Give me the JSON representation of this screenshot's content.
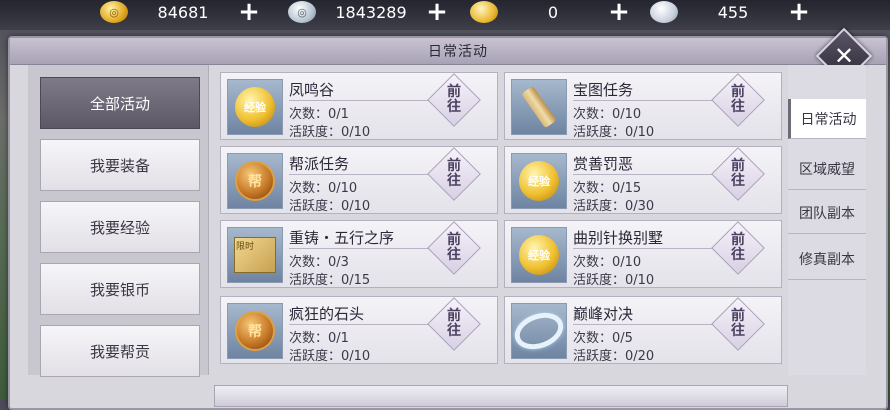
{
  "resources": [
    {
      "icon": "gold-coin-icon",
      "value": "84681"
    },
    {
      "icon": "silver-coin-icon",
      "value": "1843289"
    },
    {
      "icon": "gold-ingot-icon",
      "value": "0"
    },
    {
      "icon": "silver-ingot-icon",
      "value": "455"
    }
  ],
  "plus_symbol": "+",
  "panel": {
    "title": "日常活动",
    "close_symbol": "✕"
  },
  "left_nav": [
    {
      "label": "全部活动",
      "active": true
    },
    {
      "label": "我要装备",
      "active": false
    },
    {
      "label": "我要经验",
      "active": false
    },
    {
      "label": "我要银币",
      "active": false
    },
    {
      "label": "我要帮贡",
      "active": false
    }
  ],
  "activities": [
    {
      "name": "凤鸣谷",
      "icon": "exp-orb-icon",
      "icon_text": "经验",
      "count": "次数：0/1",
      "activity": "活跃度：0/10"
    },
    {
      "name": "宝图任务",
      "icon": "scroll-icon",
      "icon_text": "",
      "count": "次数：0/10",
      "activity": "活跃度：0/10"
    },
    {
      "name": "帮派任务",
      "icon": "guild-orb-icon",
      "icon_text": "帮",
      "count": "次数：0/10",
      "activity": "活跃度：0/10"
    },
    {
      "name": "赏善罚恶",
      "icon": "exp-orb-icon",
      "icon_text": "经验",
      "count": "次数：0/15",
      "activity": "活跃度：0/30"
    },
    {
      "name": "重铸・五行之序",
      "icon": "map-icon",
      "icon_text": "限时",
      "count": "次数：0/3",
      "activity": "活跃度：0/15"
    },
    {
      "name": "曲别针换别墅",
      "icon": "exp-orb-icon",
      "icon_text": "经验",
      "count": "次数：0/10",
      "activity": "活跃度：0/10"
    },
    {
      "name": "疯狂的石头",
      "icon": "guild-orb-icon",
      "icon_text": "帮",
      "count": "次数：0/1",
      "activity": "活跃度：0/10"
    },
    {
      "name": "巅峰对决",
      "icon": "ring-icon",
      "icon_text": "",
      "count": "次数：0/5",
      "activity": "活跃度：0/20"
    }
  ],
  "go_label_top": "前",
  "go_label_bottom": "往",
  "right_tabs": [
    {
      "label": "日常活动",
      "active": true
    },
    {
      "label": "区域威望",
      "active": false
    },
    {
      "label": "团队副本",
      "active": false
    },
    {
      "label": "修真副本",
      "active": false
    }
  ],
  "colors": {
    "panel_bg": "#d9d7de",
    "active_nav": "#6e6a78",
    "text_dark": "#2c2838"
  }
}
